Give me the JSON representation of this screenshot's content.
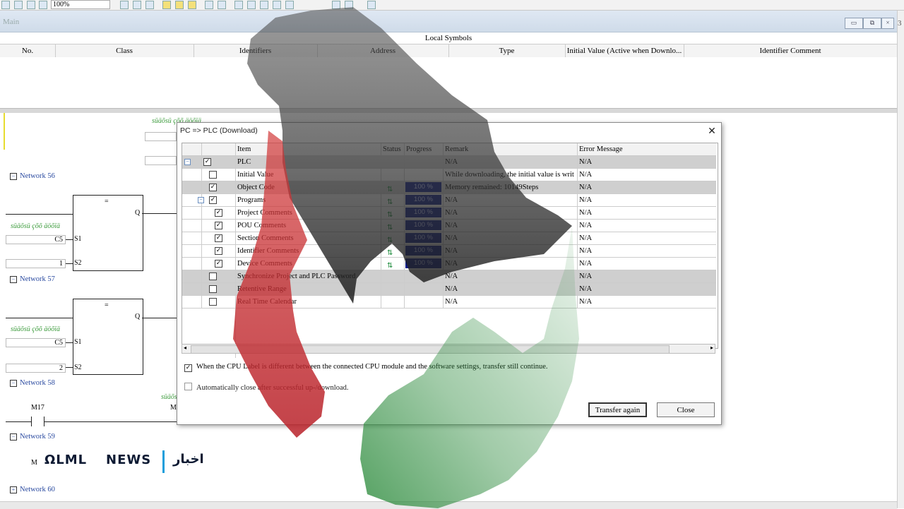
{
  "toolbar": {
    "zoom": "100%"
  },
  "window": {
    "title": "Main",
    "min": "▭",
    "restore": "⧉",
    "side_number": "3"
  },
  "local_symbols": {
    "title": "Local Symbols",
    "columns": [
      "No.",
      "Class",
      "Identifiers",
      "Address",
      "Type",
      "Initial Value (Active when Downlo...",
      "Identifier Comment"
    ]
  },
  "ladder": {
    "networks": [
      "Network 56",
      "Network 57",
      "Network 58",
      "Network 59",
      "Network 60"
    ],
    "comment_text": "süäõsü çõõ äöõïä",
    "fb1": {
      "op": "=",
      "out": "Q",
      "s1": "S1",
      "s2": "S2",
      "in1": "C5",
      "in2": "1"
    },
    "fb2": {
      "op": "=",
      "out": "Q",
      "s1": "S1",
      "s2": "S2",
      "in1": "C5",
      "in2": "2"
    },
    "contact": "M17",
    "contact2": "M",
    "coil_label": "M",
    "contact3": "M"
  },
  "dialog": {
    "title": "PC => PLC (Download)",
    "close": "✕",
    "columns": [
      "Item",
      "Status",
      "Progress",
      "Remark",
      "Error Message"
    ],
    "rows": [
      {
        "item": "PLC",
        "checked": true,
        "tree": "−",
        "indent": 0,
        "gray": true,
        "remark": "N/A",
        "error": "N/A"
      },
      {
        "item": "Initial Value",
        "checked": false,
        "indent": 1,
        "gray": false,
        "remark": "While downloading, the initial value is writ",
        "error": "N/A"
      },
      {
        "item": "Object Code",
        "checked": true,
        "indent": 1,
        "gray": true,
        "status": "⇅",
        "progress": "100 %",
        "remark": "Memory remained: 10149Steps",
        "error": "N/A"
      },
      {
        "item": "Programs",
        "checked": true,
        "tree": "−",
        "indent": 1,
        "gray": false,
        "status": "⇅",
        "progress": "100 %",
        "remark": "N/A",
        "error": "N/A"
      },
      {
        "item": "Project Comments",
        "checked": true,
        "indent": 2,
        "gray": false,
        "status": "⇅",
        "progress": "100 %",
        "remark": "N/A",
        "error": "N/A"
      },
      {
        "item": "POU Comments",
        "checked": true,
        "indent": 2,
        "gray": false,
        "status": "⇅",
        "progress": "100 %",
        "remark": "N/A",
        "error": "N/A"
      },
      {
        "item": "Section Comments",
        "checked": true,
        "indent": 2,
        "gray": false,
        "status": "⇅",
        "progress": "100 %",
        "remark": "N/A",
        "error": "N/A"
      },
      {
        "item": "Identifier Comments",
        "checked": true,
        "indent": 2,
        "gray": false,
        "status": "⇅",
        "progress": "100 %",
        "remark": "N/A",
        "error": "N/A"
      },
      {
        "item": "Device Comments",
        "checked": true,
        "indent": 2,
        "gray": false,
        "status": "⇅",
        "progress": "100 %",
        "remark": "N/A",
        "error": "N/A"
      },
      {
        "item": "Synchronize Project and PLC Password",
        "checked": false,
        "indent": 1,
        "gray": true,
        "remark": "N/A",
        "error": "N/A"
      },
      {
        "item": "Retentive Range",
        "checked": false,
        "indent": 1,
        "gray": true,
        "remark": "N/A",
        "error": "N/A"
      },
      {
        "item": "Real Time Calendar",
        "checked": false,
        "indent": 1,
        "gray": false,
        "remark": "N/A",
        "error": "N/A"
      }
    ],
    "option1": {
      "checked": true,
      "label": "When the CPU Label is different between the connected CPU module and the software settings, transfer still continue."
    },
    "option2": {
      "checked": false,
      "label": "Automatically close after successful up-/download."
    },
    "btn_again": "Transfer again",
    "btn_close": "Close"
  },
  "overlay_colors": {
    "gray": "#3a3a3a",
    "red": "#c0282d",
    "green": "#2e8b3e"
  },
  "news": {
    "brand": "ΩLML",
    "word": "NEWS",
    "arabic": "اخبار"
  }
}
